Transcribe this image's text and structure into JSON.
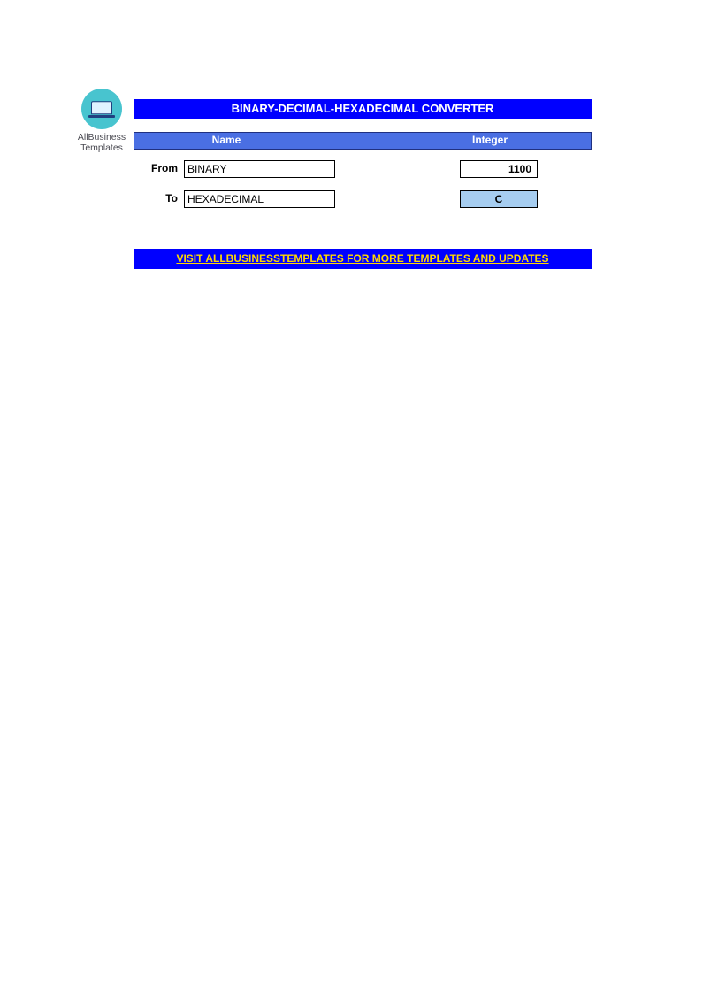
{
  "logo": {
    "line1": "AllBusiness",
    "line2": "Templates",
    "icon": "laptop-icon"
  },
  "title": "BINARY-DECIMAL-HEXADECIMAL CONVERTER",
  "headers": {
    "name": "Name",
    "integer": "Integer"
  },
  "rows": {
    "from": {
      "label": "From",
      "name": "BINARY",
      "integer": "1100"
    },
    "to": {
      "label": "To",
      "name": "HEXADECIMAL",
      "integer": "C"
    }
  },
  "footer_link": "VISIT ALLBUSINESSTEMPLATES FOR MORE TEMPLATES AND UPDATES",
  "colors": {
    "primary": "#0000ff",
    "header_row": "#4a6fe3",
    "result_cell": "#a6cdf0",
    "link_text": "#ffd900",
    "logo_circle": "#48c4cf"
  }
}
